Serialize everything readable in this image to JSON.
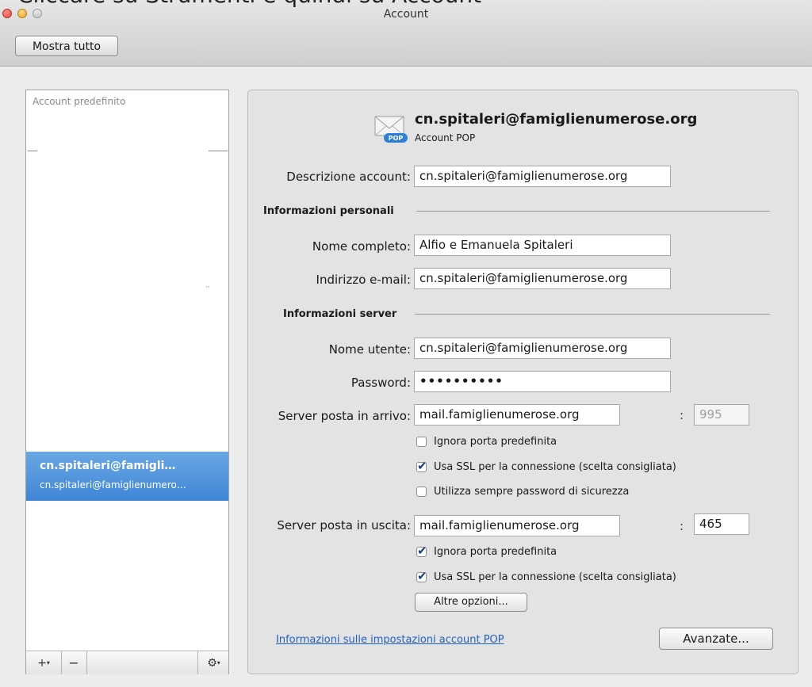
{
  "caption": "Cliccare su Strumenti e quindi su Account",
  "window": {
    "title": "Account"
  },
  "toolbar": {
    "show_all_label": "Mostra tutto"
  },
  "sidebar": {
    "section_label": "Account predefinito",
    "selected_account": {
      "name": "cn.spitaleri@famigli…",
      "subtitle": "cn.spitaleri@famiglienumero…"
    },
    "toolbar": {
      "add_label": "+",
      "remove_label": "−"
    }
  },
  "account": {
    "email": "cn.spitaleri@famiglienumerose.org",
    "type": "Account POP",
    "badge": "POP",
    "description_label": "Descrizione account:",
    "description_value": "cn.spitaleri@famiglienumerose.org"
  },
  "personal": {
    "section_title": "Informazioni personali",
    "fullname_label": "Nome completo:",
    "fullname_value": "Alfio e Emanuela Spitaleri",
    "email_label": "Indirizzo e-mail:",
    "email_value": "cn.spitaleri@famiglienumerose.org"
  },
  "server": {
    "section_title": "Informazioni server",
    "username_label": "Nome utente:",
    "username_value": "cn.spitaleri@famiglienumerose.org",
    "password_label": "Password:",
    "password_value": "••••••••••",
    "incoming_label": "Server posta in arrivo:",
    "incoming_value": "mail.famiglienumerose.org",
    "incoming_port": "995",
    "incoming_options": [
      {
        "label": "Ignora porta predefinita",
        "checked": false
      },
      {
        "label": "Usa SSL per la connessione (scelta consigliata)",
        "checked": true
      },
      {
        "label": "Utilizza sempre password di sicurezza",
        "checked": false
      }
    ],
    "outgoing_label": "Server posta in uscita:",
    "outgoing_value": "mail.famiglienumerose.org",
    "outgoing_port": "465",
    "outgoing_options": [
      {
        "label": "Ignora porta predefinita",
        "checked": true
      },
      {
        "label": "Usa SSL per la connessione (scelta consigliata)",
        "checked": true
      }
    ],
    "more_options_label": "Altre opzioni..."
  },
  "footer": {
    "info_link": "Informazioni sulle impostazioni account POP",
    "advanced_label": "Avanzate..."
  }
}
